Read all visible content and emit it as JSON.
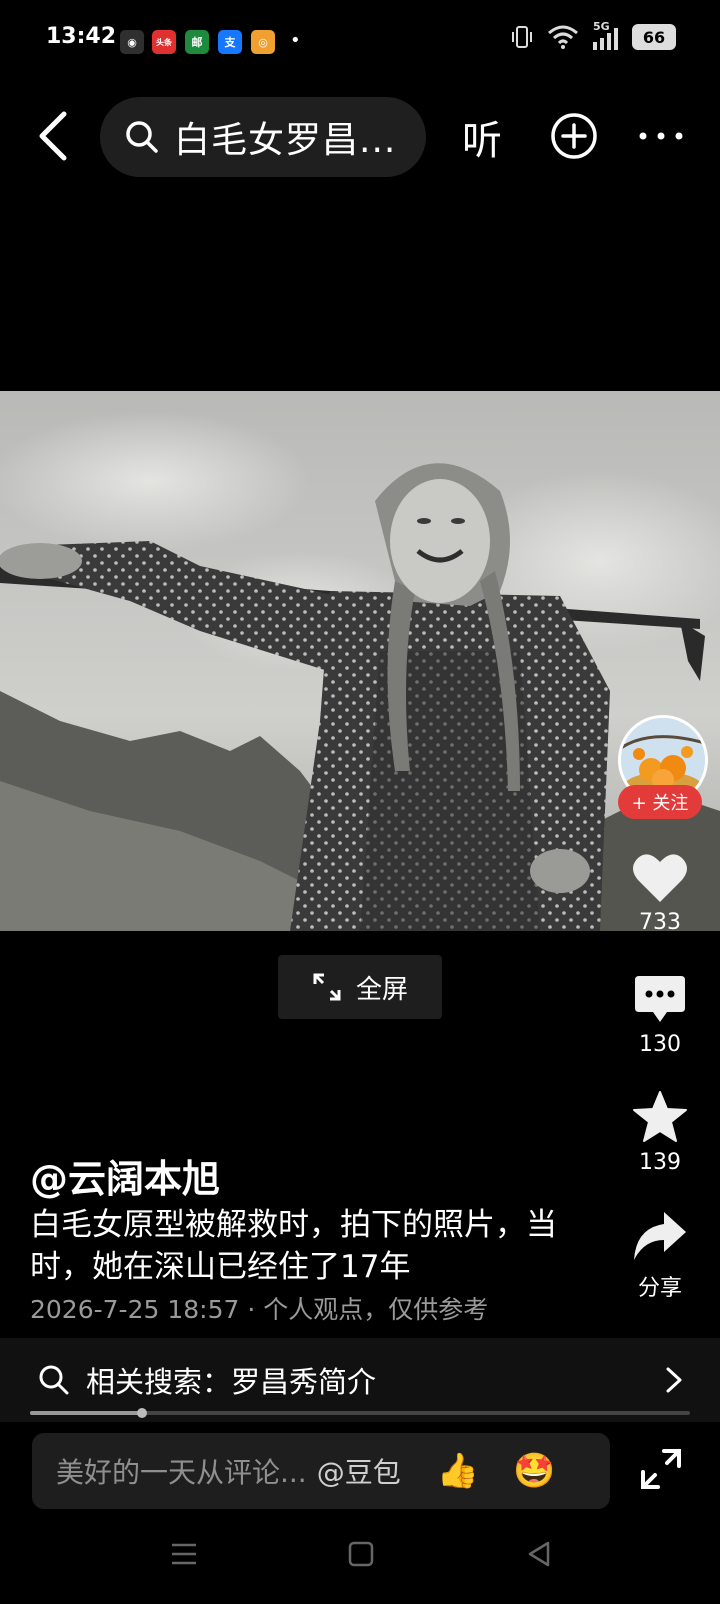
{
  "status_bar": {
    "time": "13:42",
    "apps": [
      {
        "name": "wechat-icon",
        "glyph": "◉",
        "color": "#2f2f2f"
      },
      {
        "name": "toutiao-icon",
        "glyph": "头条",
        "color": "#e03030"
      },
      {
        "name": "post-icon",
        "glyph": "邮",
        "color": "#1e8a3e"
      },
      {
        "name": "alipay-icon",
        "glyph": "支",
        "color": "#1677ff"
      },
      {
        "name": "gallery-icon",
        "glyph": "◎",
        "color": "#f0a030"
      }
    ],
    "dot": "•",
    "network": "5G",
    "battery": "66"
  },
  "top_nav": {
    "search_query": "白毛女罗昌...",
    "listen_label": "听"
  },
  "video": {
    "fullscreen_label": "全屏"
  },
  "right_rail": {
    "follow_label": "+ 关注",
    "likes": "733",
    "comments": "130",
    "favorites": "139",
    "share_label": "分享"
  },
  "caption": {
    "author": "@云阔本旭",
    "description": "白毛女原型被解救时，拍下的照片，当时，她在深山已经住了17年",
    "meta": "2026-7-25 18:57 · 个人观点，仅供参考"
  },
  "related_search": {
    "label": "相关搜索：罗昌秀简介"
  },
  "progress": {
    "fraction": 0.17
  },
  "comment_bar": {
    "placeholder": "美好的一天从评论...",
    "mention": "@豆包",
    "emoji_1": "👍",
    "emoji_2": "🤩"
  }
}
